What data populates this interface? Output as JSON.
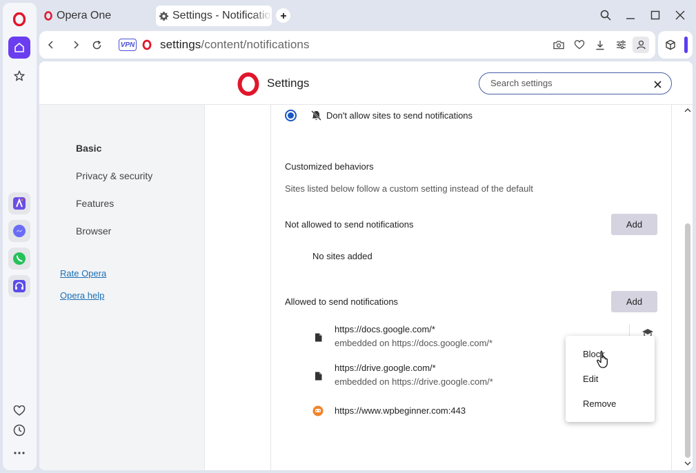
{
  "tabs": [
    {
      "label": "Opera One"
    },
    {
      "label": "Settings - Notifications"
    }
  ],
  "address_bar": {
    "host": "settings",
    "path": "/content/notifications",
    "vpn_label": "VPN"
  },
  "header": {
    "title": "Settings",
    "search_placeholder": "Search settings"
  },
  "nav": {
    "items": [
      "Basic",
      "Privacy & security",
      "Features",
      "Browser"
    ],
    "links": [
      "Rate Opera",
      "Opera help"
    ]
  },
  "content": {
    "default_option": "Don't allow sites to send notifications",
    "custom_title": "Customized behaviors",
    "custom_desc": "Sites listed below follow a custom setting instead of the default",
    "not_allowed_title": "Not allowed to send notifications",
    "add_label": "Add",
    "no_sites": "No sites added",
    "allowed_title": "Allowed to send notifications",
    "allowed_sites": [
      {
        "url": "https://docs.google.com/*",
        "sub": "embedded on https://docs.google.com/*"
      },
      {
        "url": "https://drive.google.com/*",
        "sub": "embedded on https://drive.google.com/*"
      },
      {
        "url": "https://www.wpbeginner.com:443",
        "sub": ""
      }
    ]
  },
  "context_menu": {
    "items": [
      "Block",
      "Edit",
      "Remove"
    ]
  },
  "colors": {
    "opera_red": "#e0172c",
    "accent_blue": "#1a56c4",
    "link_blue": "#1a6fb5",
    "add_button_bg": "#d5d3df"
  }
}
